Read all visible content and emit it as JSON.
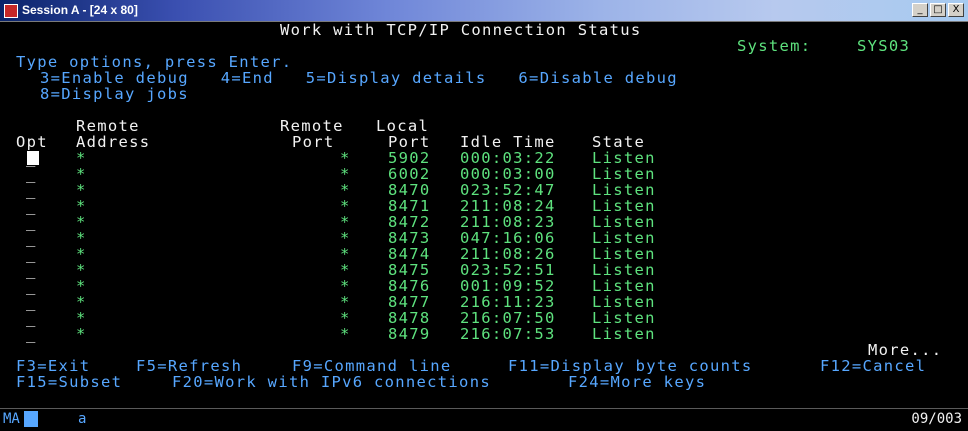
{
  "window": {
    "title": "Session A - [24 x 80]",
    "buttons": [
      "_",
      "□",
      "X"
    ]
  },
  "screen": {
    "title": "Work with TCP/IP Connection Status",
    "system_label": "System:",
    "system_value": "SYS03",
    "instructions": "Type options, press Enter.",
    "options_line1": "3=Enable debug   4=End   5=Display details   6=Disable debug",
    "options_line2": "8=Display jobs",
    "headers": {
      "remote1": "Remote",
      "remote2": "Remote",
      "local1": "Local",
      "opt": "Opt",
      "address": "Address",
      "port": "Port",
      "lport": "Port",
      "idle": "Idle Time",
      "state": "State"
    },
    "rows": [
      {
        "addr": "*",
        "rport": "*",
        "lport": "5902",
        "idle": "000:03:22",
        "state": "Listen"
      },
      {
        "addr": "*",
        "rport": "*",
        "lport": "6002",
        "idle": "000:03:00",
        "state": "Listen"
      },
      {
        "addr": "*",
        "rport": "*",
        "lport": "8470",
        "idle": "023:52:47",
        "state": "Listen"
      },
      {
        "addr": "*",
        "rport": "*",
        "lport": "8471",
        "idle": "211:08:24",
        "state": "Listen"
      },
      {
        "addr": "*",
        "rport": "*",
        "lport": "8472",
        "idle": "211:08:23",
        "state": "Listen"
      },
      {
        "addr": "*",
        "rport": "*",
        "lport": "8473",
        "idle": "047:16:06",
        "state": "Listen"
      },
      {
        "addr": "*",
        "rport": "*",
        "lport": "8474",
        "idle": "211:08:26",
        "state": "Listen"
      },
      {
        "addr": "*",
        "rport": "*",
        "lport": "8475",
        "idle": "023:52:51",
        "state": "Listen"
      },
      {
        "addr": "*",
        "rport": "*",
        "lport": "8476",
        "idle": "001:09:52",
        "state": "Listen"
      },
      {
        "addr": "*",
        "rport": "*",
        "lport": "8477",
        "idle": "216:11:23",
        "state": "Listen"
      },
      {
        "addr": "*",
        "rport": "*",
        "lport": "8478",
        "idle": "216:07:50",
        "state": "Listen"
      },
      {
        "addr": "*",
        "rport": "*",
        "lport": "8479",
        "idle": "216:07:53",
        "state": "Listen"
      }
    ],
    "more": "More...",
    "fkeys_line1": [
      "F3=Exit",
      "F5=Refresh",
      "F9=Command line",
      "F11=Display byte counts",
      "F12=Cancel"
    ],
    "fkeys_line2": [
      "F15=Subset",
      "F20=Work with IPv6 connections",
      "F24=More keys"
    ]
  },
  "status": {
    "mode": "MA",
    "keyboard": "a",
    "cursor_pos": "09/003"
  },
  "colors": {
    "background": "#000000",
    "white": "#f2f2f2",
    "blue": "#57a7ff",
    "green": "#5ee27e"
  }
}
